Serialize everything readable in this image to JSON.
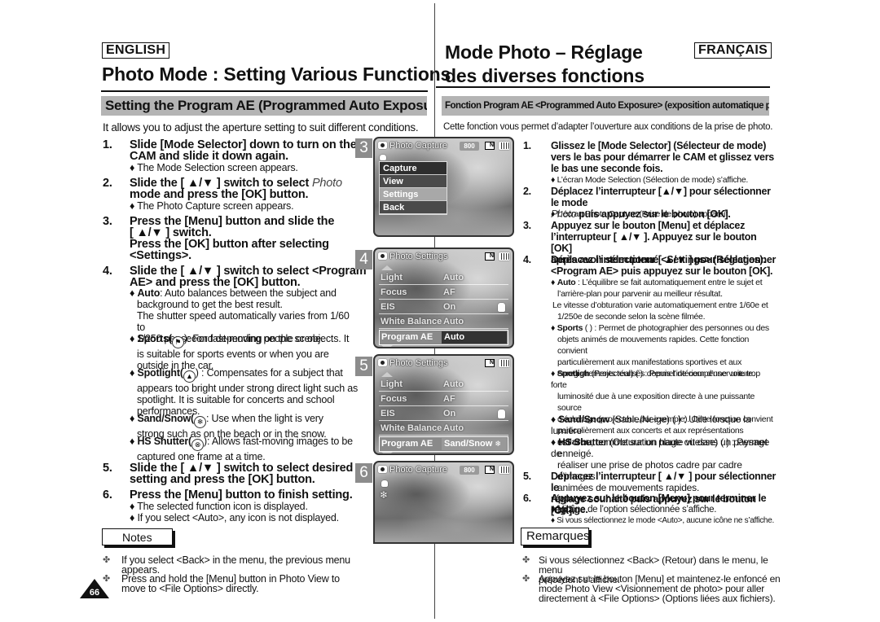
{
  "header": {
    "en_lang": "ENGLISH",
    "fr_lang": "FRANÇAIS",
    "en_title": "Photo Mode : Setting Various Functions",
    "fr_title_line1": "Mode Photo – Réglage",
    "fr_title_line2": "des diverses fonctions"
  },
  "en": {
    "section": "Setting the Program AE (Programmed Auto Exposure)",
    "intro": "It allows you to adjust the aperture setting to suit different conditions.",
    "steps": [
      {
        "num": "1.",
        "line1": "Slide [Mode Selector] down to turn on the",
        "line2": "CAM and slide it down again.",
        "bullet": "♦ The Mode Selection screen appears."
      },
      {
        "num": "2.",
        "line1a": "Slide the [ ▲/▼ ] switch to select ",
        "line1b": "Photo",
        "line2": "mode and press the [OK] button.",
        "bullet": "♦ The Photo Capture screen appears."
      },
      {
        "num": "3.",
        "line1": "Press the [Menu] button and slide the",
        "line2": "[ ▲/▼ ] switch.",
        "line3": "Press the [OK] button after selecting",
        "line4": "<Settings>."
      },
      {
        "num": "4.",
        "line1": "Slide the [ ▲/▼ ] switch to select <Program",
        "line2": "AE> and press the [OK] button."
      },
      {
        "num": "5.",
        "line1": "Slide the [ ▲/▼ ] switch to select desired",
        "line2": "setting and press the [OK] button."
      },
      {
        "num": "6.",
        "line1": "Press the [Menu] button to finish setting.",
        "bullet1": "♦ The selected function icon is displayed.",
        "bullet2": "♦ If you select <Auto>, any icon is not displayed."
      }
    ],
    "options": [
      {
        "name": "Auto",
        "lines": [
          ": Auto balances between the subject and",
          "background to get the best result.",
          "The shutter speed automatically varies from 1/60 to",
          "1/250 per second depending on the scene."
        ]
      },
      {
        "name": "Sports(",
        "icon": "sports-icon",
        "lines": "): For fast-moving people or objects. It",
        "cont": [
          "is suitable for sports events or when you are",
          "outside in the car."
        ]
      },
      {
        "name": "Spotlight(",
        "icon": "spotlight-icon",
        "lines": ") : Compensates for a subject that",
        "cont": [
          "appears too bright under strong direct light such as",
          "spotlight. It is suitable for concerts and school",
          "performances."
        ]
      },
      {
        "name": "Sand/Snow(",
        "icon": "snowflake-icon",
        "lines": ": Use when the light is very",
        "cont": [
          "strong such as on the beach or in the snow."
        ]
      },
      {
        "name": "HS Shutter(",
        "icon": "hs-shutter-icon",
        "lines": "): Allows fast-moving images to be",
        "cont": [
          "captured one frame at a time."
        ]
      }
    ],
    "notes_label": "Notes",
    "notes": [
      {
        "line1": "If you select <Back> in the menu, the previous menu",
        "line2": "appears."
      },
      {
        "line1": "Press and hold the [Menu] button in Photo View to",
        "line2": "move to <File Options> directly."
      }
    ],
    "page_number": "66"
  },
  "fr": {
    "section": "Fonction Program AE <Programmed Auto Exposure> (exposition automatique programmable)",
    "intro": "Cette fonction vous permet d’adapter l’ouverture aux conditions de la prise de photo.",
    "steps": [
      {
        "num": "1.",
        "lines": [
          "Glissez le [Mode Selector] (Sélecteur de mode)",
          "vers le bas pour démarrer le CAM et glissez vers",
          "le bas une seconde fois."
        ],
        "bullet": "♦ L’écran Mode Selection (Sélection de mode) s’affiche."
      },
      {
        "num": "2.",
        "line1": "Déplacez l’interrupteur [▲/▼] pour sélectionner le mode",
        "line2a": "Photo",
        "line2b": " puis appuyez sur le bouton [OK].",
        "bullet": "♦ L’écran Photo Capture (Prise de photo) apparaît."
      },
      {
        "num": "3.",
        "lines": [
          "Appuyez sur le bouton [Menu] et déplacez",
          "l’interrupteur [ ▲/▼ ]. Appuyez sur le bouton [OK]",
          "après avoir sélectionné <Settings> (Réglages)."
        ]
      },
      {
        "num": "4.",
        "lines": [
          "Déplacez l’interrupteur [ ▲/▼ ] pour sélectionner",
          "<Program AE> puis appuyez sur le bouton [OK]."
        ]
      },
      {
        "num": "5.",
        "lines": [
          "Déplacez l’interrupteur [ ▲/▼ ] pour sélectionner le",
          "réglage souhaité puis appuyez sur le bouton [OK]."
        ]
      },
      {
        "num": "6.",
        "lines": [
          "Appuyez sur le bouton [Menu] pour terminer le réglage."
        ],
        "bullet1": "♦ L’icône de l’option sélectionnée s’affiche.",
        "bullet2": "♦ Si vous sélectionnez le mode <Auto>, aucune icône ne s’affiche."
      }
    ],
    "options": [
      {
        "name": "Auto",
        "lines": [
          " : L’équilibre se fait automatiquement entre le sujet et",
          "l’arrière-plan pour parvenir au meilleur résultat.",
          "Le vitesse d’obturation varie automatiquement entre 1/60e et",
          "1/250e de seconde selon la scène filmée."
        ]
      },
      {
        "name": "Sports",
        "first": " ( ) : Permet de photographier des personnes ou des",
        "cont": [
          "objets animés de mouvements rapides. Cette fonction convient",
          "particulièrement aux manifestations sportives et aux",
          "enregistrements réalisés depuis l’intérieur d’une voiture."
        ]
      },
      {
        "name": "Spotligh",
        "first": " (Projecteur) ( ) : Permet de compenser une trop forte",
        "cont": [
          "luminosité due à une exposition directe à une puissante source",
          "d’éclairage (projecteur, par exemple). Cette fonction convient",
          "particulièrement aux concerts et aux représentations scolaires."
        ]
      },
      {
        "name": "Sand/Snow",
        "first": " (Sable/Neige) ( ) : Utile lorsque la lumière",
        "cont": [
          "est crue, comme sur un plage ou dans un paysage enneigé."
        ]
      },
      {
        "name": "HS Shutter",
        "first": " (Obturation haute vitesse) ( ) : Permet de",
        "cont": [
          "réaliser une prise de photos cadre par cadre d’images",
          "animées de mouvements rapides."
        ]
      }
    ],
    "notes_label": "Remarques",
    "notes": [
      {
        "line1": "Si vous sélectionnez <Back> (Retour) dans le menu, le menu",
        "line2": "précédent s’affiche."
      },
      {
        "line1": "Appuyez sur le bouton [Menu] et maintenez-le enfoncé en",
        "line2": "mode Photo View <Visionnement de photo> pour aller",
        "line3": "directement à <File Options> (Options liées aux fichiers)."
      }
    ]
  },
  "screens": [
    {
      "step": "3",
      "title": "Photo Capture",
      "resolution": "800",
      "menu": [
        "Capture",
        "View",
        "Settings",
        "Back"
      ],
      "selected_index": 2
    },
    {
      "step": "4",
      "title": "Photo Settings",
      "rows": [
        [
          "Light",
          "Auto"
        ],
        [
          "Focus",
          "AF"
        ],
        [
          "EIS",
          "On"
        ],
        [
          "White Balance",
          "Auto"
        ]
      ],
      "selected": [
        "Program AE",
        "Auto"
      ]
    },
    {
      "step": "5",
      "title": "Photo Settings",
      "rows": [
        [
          "Light",
          "Auto"
        ],
        [
          "Focus",
          "AF"
        ],
        [
          "EIS",
          "On"
        ],
        [
          "White Balance",
          "Auto"
        ]
      ],
      "selected": [
        "Program AE",
        "Sand/Snow"
      ]
    },
    {
      "step": "6",
      "title": "Photo Capture",
      "resolution": "800"
    }
  ],
  "symbols": {
    "diamond": "♦",
    "note_mark": "✤",
    "snow": "❄",
    "hs": "⊗",
    "sports": "⚑",
    "spot": "▲"
  }
}
